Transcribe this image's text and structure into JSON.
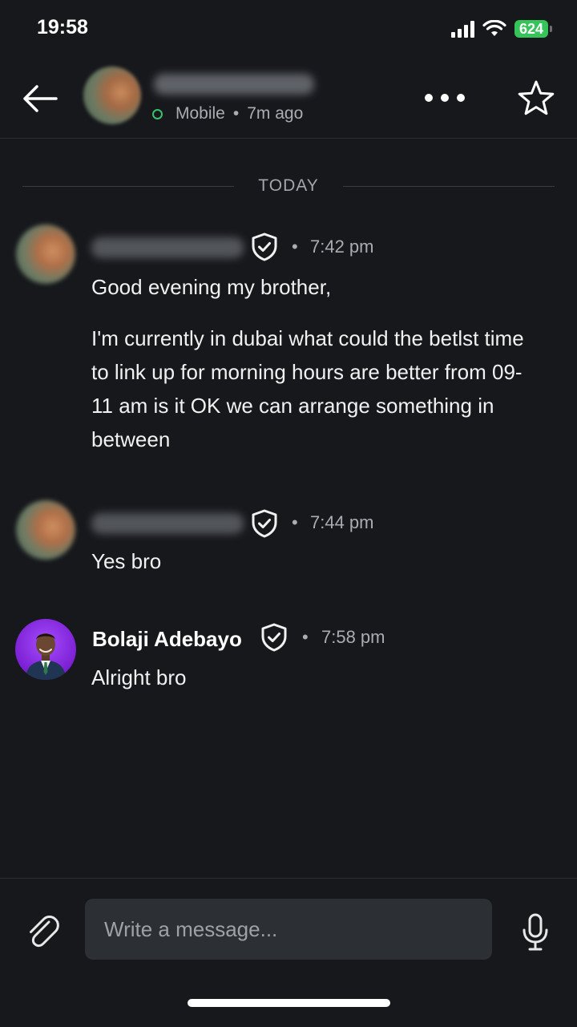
{
  "status_bar": {
    "time": "19:58",
    "battery": "624"
  },
  "header": {
    "presence": "Mobile",
    "last_seen": "7m ago",
    "separator": "•"
  },
  "divider": {
    "label": "TODAY"
  },
  "messages": [
    {
      "dot": "•",
      "time": "7:42 pm",
      "paragraphs": [
        "Good evening my brother,",
        "I'm currently in dubai what could the betlst time to link up for morning hours are better from 09-11 am is it OK we can arrange something in between"
      ]
    },
    {
      "dot": "•",
      "time": "7:44 pm",
      "paragraphs": [
        "Yes bro"
      ]
    },
    {
      "sender": "Bolaji Adebayo",
      "dot": "•",
      "time": "7:58 pm",
      "paragraphs": [
        "Alright bro"
      ]
    }
  ],
  "composer": {
    "placeholder": "Write a message..."
  },
  "colors": {
    "background": "#16181c",
    "online": "#39c16c",
    "battery": "#35c45a",
    "avatar_accent": "#7a1fd1"
  }
}
